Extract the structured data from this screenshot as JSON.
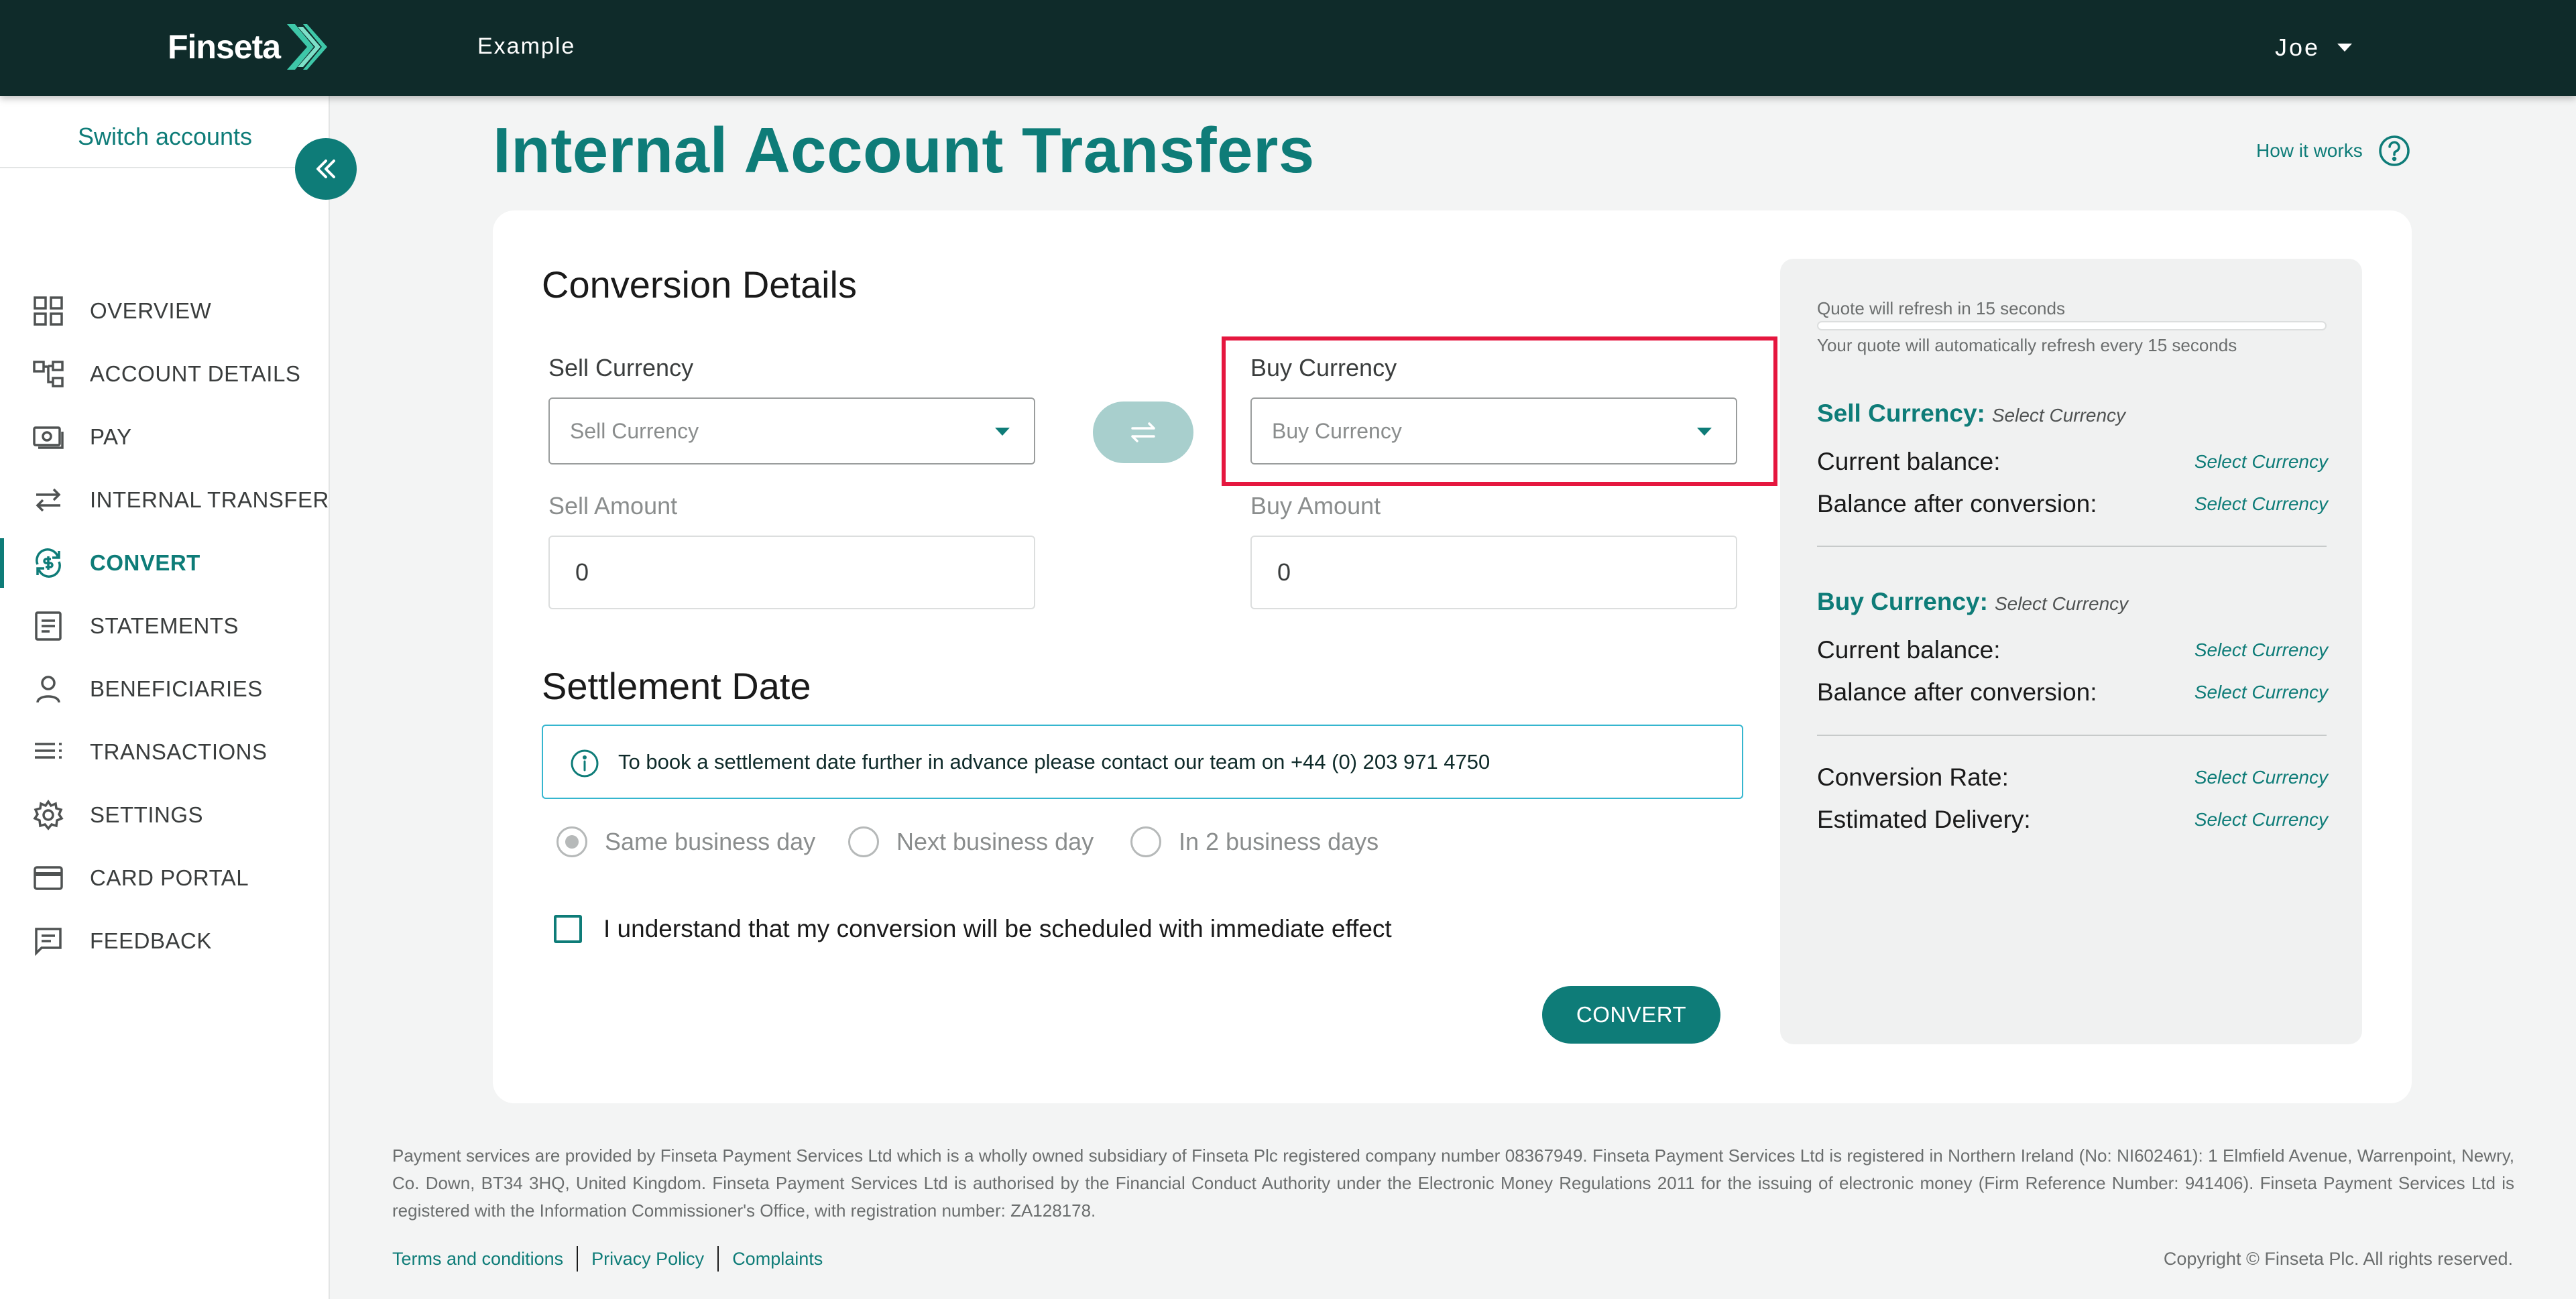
{
  "header": {
    "logo_text": "Finseta",
    "section_title": "Example",
    "user_name": "Joe"
  },
  "sidebar": {
    "switch_accounts": "Switch accounts",
    "items": [
      {
        "label": "OVERVIEW",
        "icon": "grid-icon",
        "active": false
      },
      {
        "label": "ACCOUNT DETAILS",
        "icon": "hierarchy-icon",
        "active": false
      },
      {
        "label": "PAY",
        "icon": "banknote-icon",
        "active": false
      },
      {
        "label": "INTERNAL TRANSFER",
        "icon": "swap-arrows-icon",
        "active": false
      },
      {
        "label": "CONVERT",
        "icon": "currency-exchange-icon",
        "active": true
      },
      {
        "label": "STATEMENTS",
        "icon": "document-icon",
        "active": false
      },
      {
        "label": "BENEFICIARIES",
        "icon": "person-icon",
        "active": false
      },
      {
        "label": "TRANSACTIONS",
        "icon": "list-icon",
        "active": false
      },
      {
        "label": "SETTINGS",
        "icon": "gear-icon",
        "active": false
      },
      {
        "label": "CARD PORTAL",
        "icon": "credit-card-icon",
        "active": false
      },
      {
        "label": "FEEDBACK",
        "icon": "chat-icon",
        "active": false
      }
    ]
  },
  "page": {
    "title": "Internal Account Transfers",
    "how_it_works": "How it works"
  },
  "conversion": {
    "heading": "Conversion Details",
    "sell_currency_label": "Sell Currency",
    "sell_currency_value": "Sell Currency",
    "buy_currency_label": "Buy Currency",
    "buy_currency_value": "Buy Currency",
    "sell_amount_label": "Sell Amount",
    "sell_amount_value": "0",
    "buy_amount_label": "Buy Amount",
    "buy_amount_value": "0"
  },
  "settlement": {
    "heading": "Settlement Date",
    "info": "To book a settlement date further in advance please contact our team on +44 (0) 203 971 4750",
    "options": [
      {
        "label": "Same business day",
        "selected": true
      },
      {
        "label": "Next business day",
        "selected": false
      },
      {
        "label": "In 2 business days",
        "selected": false
      }
    ],
    "confirm_text": "I understand that my conversion will be scheduled with immediate effect",
    "convert_button": "CONVERT"
  },
  "quote": {
    "refresh_text": "Quote will refresh in 15 seconds",
    "refresh_progress": 0,
    "auto_refresh_text": "Your quote will automatically refresh every 15 seconds",
    "sell_heading": "Sell Currency:",
    "sell_heading_value": "Select Currency",
    "buy_heading": "Buy Currency:",
    "buy_heading_value": "Select Currency",
    "current_balance_label": "Current balance:",
    "balance_after_label": "Balance after conversion:",
    "sell_current_balance": "Select Currency",
    "sell_balance_after": "Select Currency",
    "buy_current_balance": "Select Currency",
    "buy_balance_after": "Select Currency",
    "conversion_rate_label": "Conversion Rate:",
    "conversion_rate_value": "Select Currency",
    "estimated_delivery_label": "Estimated Delivery:",
    "estimated_delivery_value": "Select Currency"
  },
  "footer": {
    "legal": "Payment services are provided by Finseta Payment Services Ltd which is a wholly owned subsidiary of Finseta Plc registered company number 08367949. Finseta Payment Services Ltd is registered in Northern Ireland (No: NI602461): 1 Elmfield Avenue, Warrenpoint, Newry, Co. Down, BT34 3HQ, United Kingdom. Finseta Payment Services Ltd is authorised by the Financial Conduct Authority under the Electronic Money Regulations 2011 for the issuing of electronic money (Firm Reference Number: 941406). Finseta Payment Services Ltd is registered with the Information Commissioner's Office, with registration number: ZA128178.",
    "links": [
      "Terms and conditions",
      "Privacy Policy",
      "Complaints"
    ],
    "copyright": "Copyright © Finseta Plc. All rights reserved."
  },
  "colors": {
    "brand_teal": "#0e7c78",
    "header_bg": "#0f2b2a",
    "highlight_red": "#e5173f",
    "info_border": "#35b6cf"
  }
}
